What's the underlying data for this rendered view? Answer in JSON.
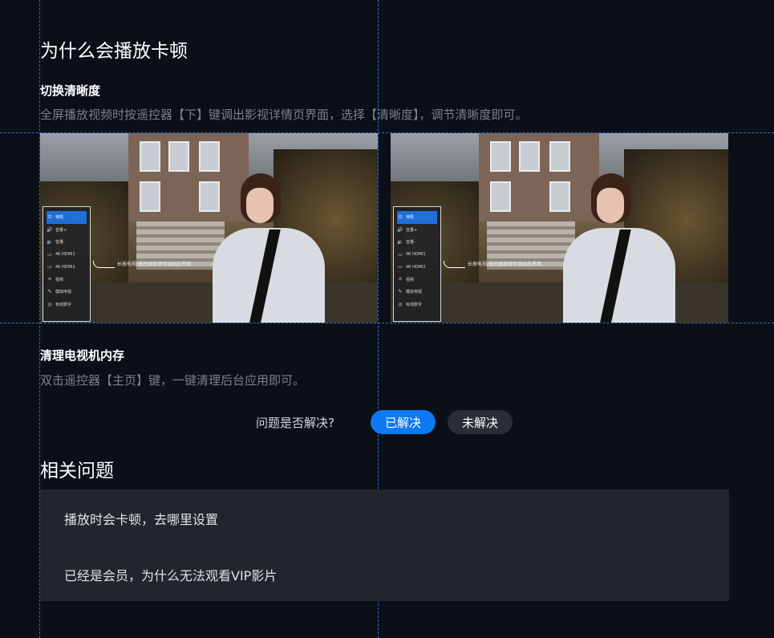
{
  "section": {
    "title": "为什么会播放卡顿"
  },
  "tips": [
    {
      "title": "切换清晰度",
      "desc": "全屏播放视频时按遥控器【下】键调出影视详情页界面，选择【清晰度】，调节清晰度即可。"
    },
    {
      "title": "清理电视机内存",
      "desc": "双击遥控器【主页】键，一键清理后台应用即可。"
    }
  ],
  "screenshot_menu": {
    "items": [
      {
        "icon": "power-icon",
        "glyph": "⏻",
        "label": "待机"
      },
      {
        "icon": "volume-up-icon",
        "glyph": "🔊",
        "label": "音量+"
      },
      {
        "icon": "volume-down-icon",
        "glyph": "🔉",
        "label": "音量-"
      },
      {
        "icon": "hdmi-icon",
        "glyph": "▭",
        "label": "4K HDMI1"
      },
      {
        "icon": "hdmi-icon",
        "glyph": "▭",
        "label": "4K HDMI2"
      },
      {
        "icon": "antenna-icon",
        "glyph": "⫛",
        "label": "视频"
      },
      {
        "icon": "analog-tv-icon",
        "glyph": "✎",
        "label": "模拟电视"
      },
      {
        "icon": "settings-icon",
        "glyph": "◎",
        "label": "有线数字"
      }
    ],
    "callout": "长按电视/遥控器按键可调出此界面"
  },
  "feedback": {
    "question": "问题是否解决?",
    "yes_label": "已解决",
    "no_label": "未解决",
    "colors": {
      "yes": "#0d79f2",
      "no": "#2a2e36"
    }
  },
  "related": {
    "title": "相关问题",
    "items": [
      "播放时会卡顿，去哪里设置",
      "已经是会员，为什么无法观看VIP影片"
    ]
  }
}
